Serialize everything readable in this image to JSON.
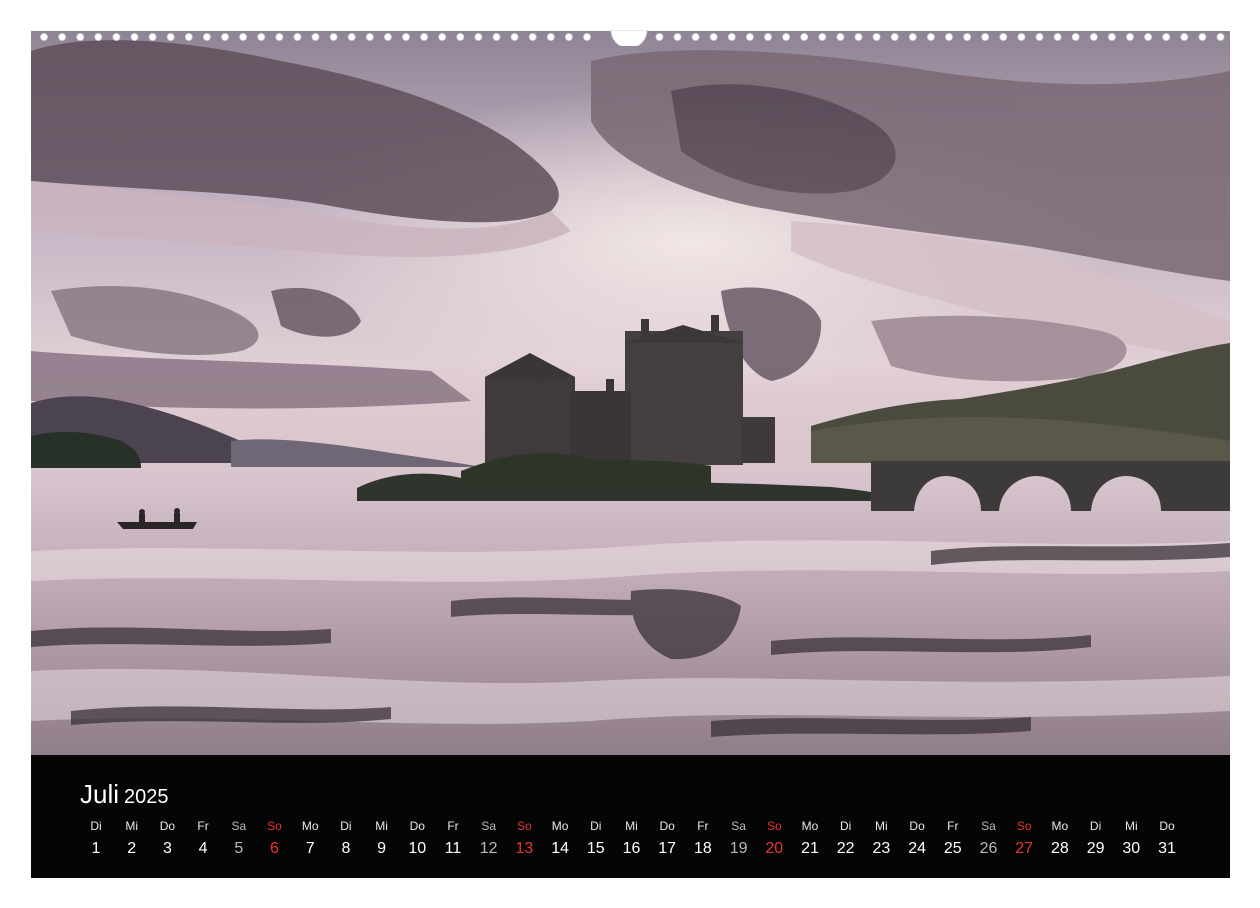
{
  "calendar": {
    "month": "Juli",
    "year": "2025",
    "days": [
      {
        "wd": "Di",
        "num": "1",
        "kind": "weekday"
      },
      {
        "wd": "Mi",
        "num": "2",
        "kind": "weekday"
      },
      {
        "wd": "Do",
        "num": "3",
        "kind": "weekday"
      },
      {
        "wd": "Fr",
        "num": "4",
        "kind": "weekday"
      },
      {
        "wd": "Sa",
        "num": "5",
        "kind": "saturday"
      },
      {
        "wd": "So",
        "num": "6",
        "kind": "sunday"
      },
      {
        "wd": "Mo",
        "num": "7",
        "kind": "weekday"
      },
      {
        "wd": "Di",
        "num": "8",
        "kind": "weekday"
      },
      {
        "wd": "Mi",
        "num": "9",
        "kind": "weekday"
      },
      {
        "wd": "Do",
        "num": "10",
        "kind": "weekday"
      },
      {
        "wd": "Fr",
        "num": "11",
        "kind": "weekday"
      },
      {
        "wd": "Sa",
        "num": "12",
        "kind": "saturday"
      },
      {
        "wd": "So",
        "num": "13",
        "kind": "sunday"
      },
      {
        "wd": "Mo",
        "num": "14",
        "kind": "weekday"
      },
      {
        "wd": "Di",
        "num": "15",
        "kind": "weekday"
      },
      {
        "wd": "Mi",
        "num": "16",
        "kind": "weekday"
      },
      {
        "wd": "Do",
        "num": "17",
        "kind": "weekday"
      },
      {
        "wd": "Fr",
        "num": "18",
        "kind": "weekday"
      },
      {
        "wd": "Sa",
        "num": "19",
        "kind": "saturday"
      },
      {
        "wd": "So",
        "num": "20",
        "kind": "sunday"
      },
      {
        "wd": "Mo",
        "num": "21",
        "kind": "weekday"
      },
      {
        "wd": "Di",
        "num": "22",
        "kind": "weekday"
      },
      {
        "wd": "Mi",
        "num": "23",
        "kind": "weekday"
      },
      {
        "wd": "Do",
        "num": "24",
        "kind": "weekday"
      },
      {
        "wd": "Fr",
        "num": "25",
        "kind": "weekday"
      },
      {
        "wd": "Sa",
        "num": "26",
        "kind": "saturday"
      },
      {
        "wd": "So",
        "num": "27",
        "kind": "sunday"
      },
      {
        "wd": "Mo",
        "num": "28",
        "kind": "weekday"
      },
      {
        "wd": "Di",
        "num": "29",
        "kind": "weekday"
      },
      {
        "wd": "Mi",
        "num": "30",
        "kind": "weekday"
      },
      {
        "wd": "Do",
        "num": "31",
        "kind": "weekday"
      }
    ]
  },
  "colors": {
    "sunday": "#e8352f",
    "saturday": "#b9b9b9",
    "strip_background": "#050505"
  }
}
